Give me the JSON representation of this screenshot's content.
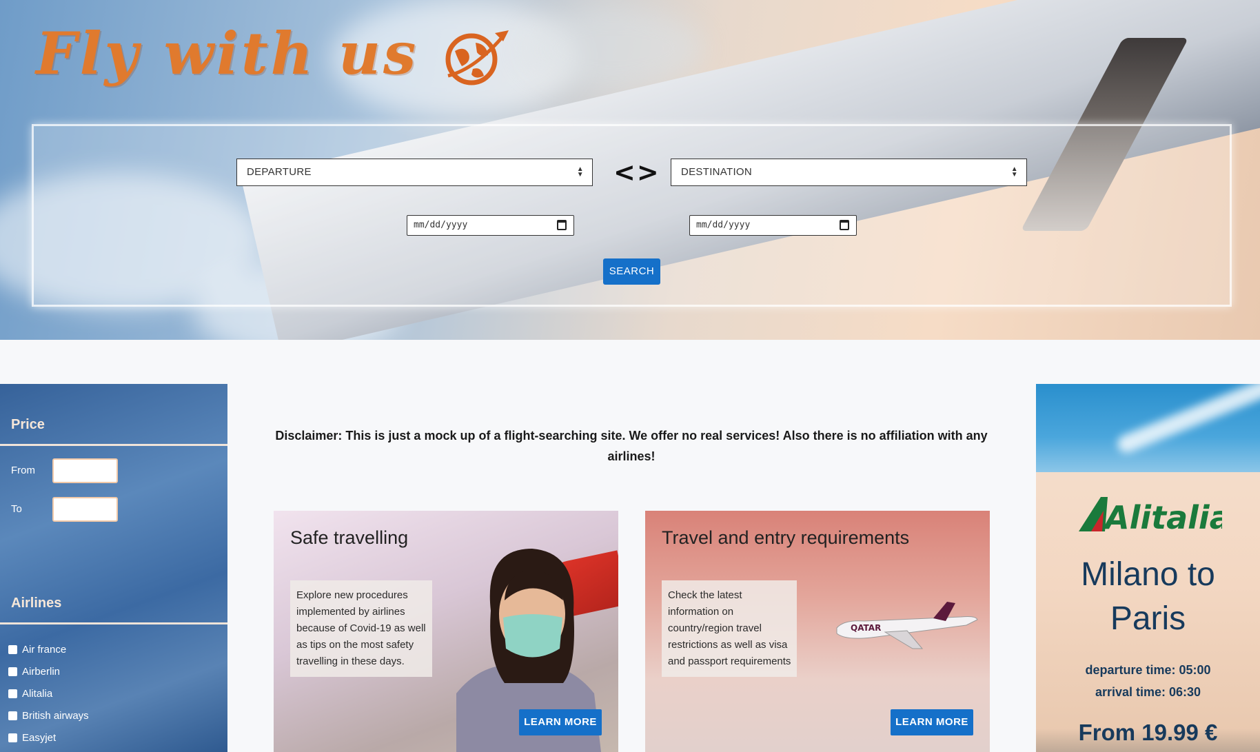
{
  "hero": {
    "title": "Fly with us",
    "departure_placeholder": "DEPARTURE",
    "destination_placeholder": "DESTINATION",
    "swap_symbol": "<>",
    "date_from_placeholder": "mm/dd/yyyy",
    "date_to_placeholder": "mm/dd/yyyy",
    "search_label": "SEARCH"
  },
  "sidebar": {
    "price_heading": "Price",
    "from_label": "From",
    "to_label": "To",
    "airlines_heading": "Airlines",
    "airlines": [
      "Air france",
      "Airberlin",
      "Alitalia",
      "British airways",
      "Easyjet"
    ]
  },
  "main": {
    "disclaimer": "Disclaimer: This is just a mock up of a flight-searching site. We offer no real services! Also there is no affiliation with any airlines!",
    "cards": [
      {
        "title": "Safe travelling",
        "text_lines": [
          "Explore new procedures",
          "implemented by airlines",
          "because of Covid-19 as well",
          "as tips on the most safety",
          "travelling in these days."
        ],
        "button": "LEARN MORE"
      },
      {
        "title": "Travel and entry requirements",
        "text_lines": [
          "Check the latest",
          "information on",
          "country/region travel",
          "restrictions as well as visa",
          "and passport requirements"
        ],
        "button": "LEARN MORE"
      }
    ]
  },
  "ad": {
    "logo_text": "Alitalia",
    "route_line1": "Milano to",
    "route_line2": "Paris",
    "departure": "departure time: 05:00",
    "arrival": "arrival time: 06:30",
    "price": "From 19.99 €"
  },
  "colors": {
    "accent_blue": "#1570c9",
    "title_orange": "#e07a2e",
    "ad_navy": "#173a5c",
    "alitalia_green": "#1a7a3c",
    "alitalia_red": "#c8262b"
  },
  "icons": [
    "globe-plane-icon",
    "calendar-icon",
    "select-arrow-icon",
    "checkbox-icon",
    "airplane-icon"
  ]
}
